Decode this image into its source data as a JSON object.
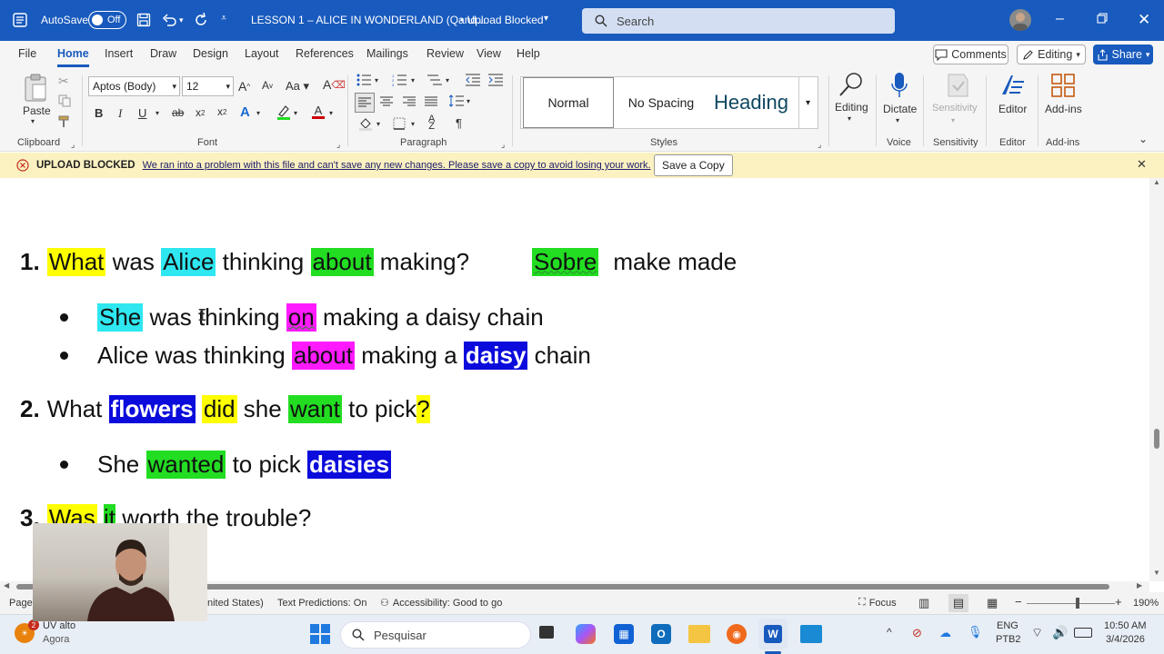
{
  "titlebar": {
    "autosave_label": "AutoSave",
    "autosave_state": "Off",
    "doc_title": "LESSON 1 – ALICE IN WONDERLAND (Qand...",
    "status": "• Upload Blocked",
    "search_placeholder": "Search"
  },
  "menu": {
    "items": [
      "File",
      "Home",
      "Insert",
      "Draw",
      "Design",
      "Layout",
      "References",
      "Mailings",
      "Review",
      "View",
      "Help"
    ],
    "comments": "Comments",
    "editing": "Editing",
    "share": "Share"
  },
  "ribbon": {
    "paste": "Paste",
    "font_name": "Aptos (Body)",
    "font_size": "12",
    "styles": {
      "normal": "Normal",
      "no_spacing": "No Spacing",
      "heading": "Heading"
    },
    "editing": "Editing",
    "dictate": "Dictate",
    "sensitivity": "Sensitivity",
    "editor": "Editor",
    "addins": "Add-ins",
    "groups": {
      "clipboard": "Clipboard",
      "font": "Font",
      "paragraph": "Paragraph",
      "styles": "Styles",
      "voice": "Voice",
      "sensitivity": "Sensitivity",
      "editor": "Editor",
      "addins": "Add-ins"
    }
  },
  "banner": {
    "title": "UPLOAD BLOCKED",
    "message": "We ran into a problem with this file and can't save any new changes. Please save a copy to avoid losing your work.",
    "button": "Save a Copy"
  },
  "document": {
    "q1": {
      "num": "1.",
      "w1": "What",
      "w2": " was ",
      "w3": "Alice",
      "w4": " thinking ",
      "w5": "about",
      "w6": " making?",
      "w7": "Sobre",
      "w8": "make made"
    },
    "a1a": {
      "w1": "She",
      "w2": " was thinking ",
      "w3": "on",
      "w4": " making a daisy chain"
    },
    "a1b": {
      "w1": "Alice was thinking ",
      "w2": "about",
      "w3": " making a ",
      "w4": "daisy",
      "w5": " chain"
    },
    "q2": {
      "num": "2.",
      "w1": "What ",
      "w2": "flowers",
      "w3": " ",
      "w4": "did",
      "w5": " she ",
      "w6": "want",
      "w7": " to pick",
      "w8": "?"
    },
    "a2": {
      "w1": "She ",
      "w2": "wanted",
      "w3": " to pick ",
      "w4": "daisies"
    },
    "q3": {
      "num": "3.",
      "w1": "Was",
      "w2": " ",
      "w3": "it",
      "w4": " worth the trouble?"
    }
  },
  "statusbar": {
    "page": "Page",
    "language": "nited States)",
    "text_predictions": "Text Predictions: On",
    "accessibility": "Accessibility: Good to go",
    "focus": "Focus",
    "zoom": "190%"
  },
  "taskbar": {
    "weather_badge": "2",
    "weather_title": "UV alto",
    "weather_sub": "Agora",
    "search": "Pesquisar",
    "lang1": "ENG",
    "lang2": "PTB2",
    "time": "10:50 AM",
    "date": "3/4/2026"
  }
}
